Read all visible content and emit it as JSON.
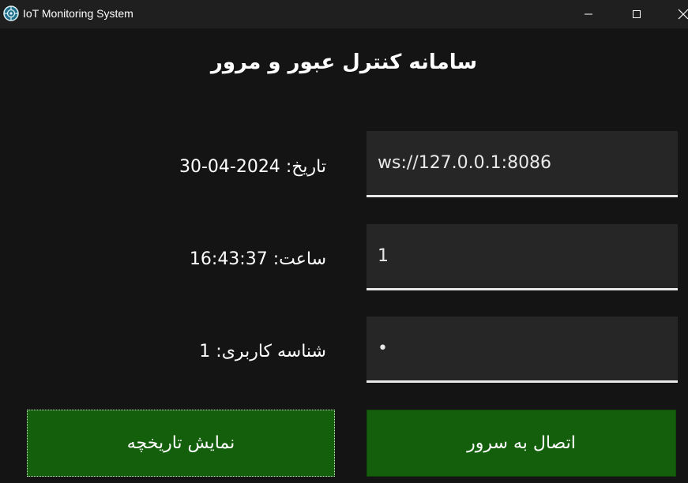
{
  "window": {
    "title": "IoT Monitoring System",
    "controls": {
      "minimize_icon": "minimize-icon",
      "maximize_icon": "maximize-icon",
      "close_icon": "close-icon"
    }
  },
  "main": {
    "heading": "سامانه کنترل عبور و مرور",
    "info": {
      "date_label": "تاریخ:",
      "date_value": "30-04-2024",
      "time_label": "ساعت:",
      "time_value": "16:43:37",
      "user_label": "شناسه کاربری:",
      "user_value": "1"
    },
    "fields": {
      "server_url": "ws://127.0.0.1:8086",
      "user_id": "1",
      "password": "•"
    },
    "buttons": {
      "history_label": "نمایش تاریخچه",
      "connect_label": "اتصال به سرور"
    }
  },
  "colors": {
    "background": "#141414",
    "titlebar": "#1f1f1f",
    "field_bg": "#262626",
    "button_green": "#145f0c",
    "text": "#ffffff"
  }
}
